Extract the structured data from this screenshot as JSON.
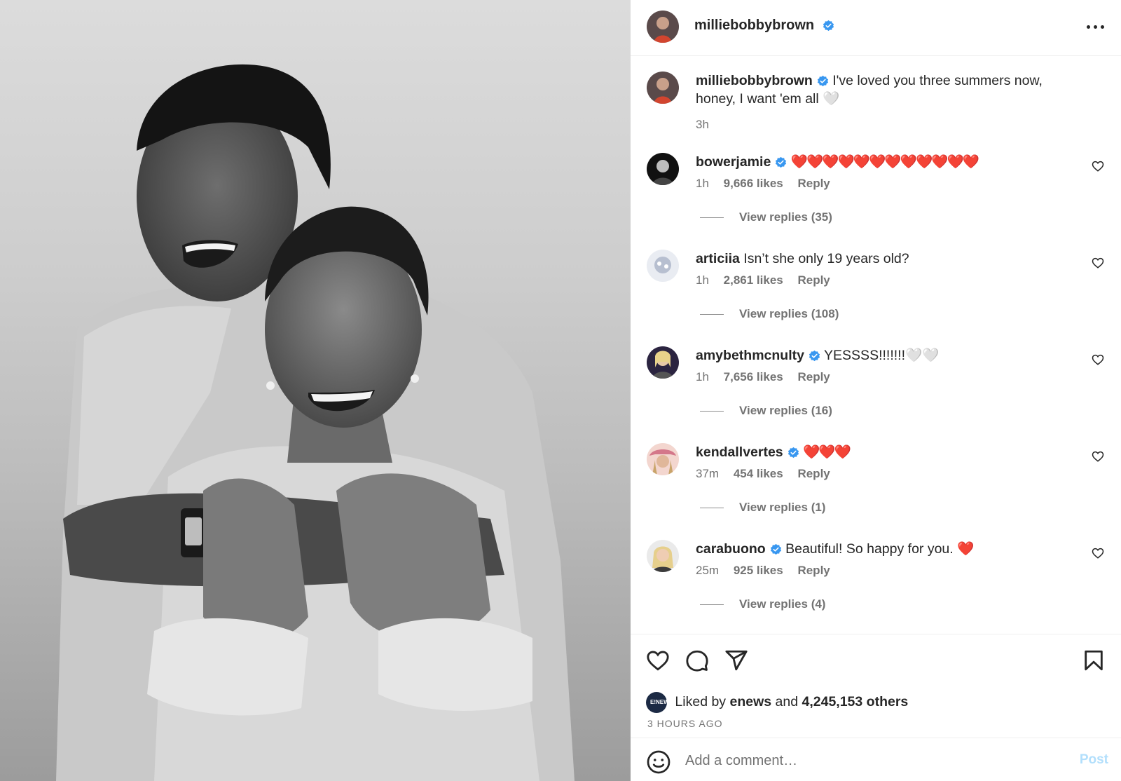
{
  "post": {
    "author": "milliebobbybrown",
    "more_label": "…",
    "caption": {
      "username": "milliebobbybrown",
      "text": "I've loved you three summers now, honey, I want 'em all 🤍",
      "time": "3h"
    }
  },
  "comments": [
    {
      "username": "bowerjamie",
      "verified": true,
      "text": "❤️❤️❤️❤️❤️❤️❤️❤️❤️❤️❤️❤️",
      "time": "1h",
      "likes": "9,666 likes",
      "reply": "Reply",
      "view_replies": "View replies (35)"
    },
    {
      "username": "articiia",
      "verified": false,
      "text": "Isn’t she only 19 years old?",
      "time": "1h",
      "likes": "2,861 likes",
      "reply": "Reply",
      "view_replies": "View replies (108)"
    },
    {
      "username": "amybethmcnulty",
      "verified": true,
      "text": "YESSSS!!!!!!!🤍🤍",
      "time": "1h",
      "likes": "7,656 likes",
      "reply": "Reply",
      "view_replies": "View replies (16)"
    },
    {
      "username": "kendallvertes",
      "verified": true,
      "text": "❤️❤️❤️",
      "time": "37m",
      "likes": "454 likes",
      "reply": "Reply",
      "view_replies": "View replies (1)"
    },
    {
      "username": "carabuono",
      "verified": true,
      "text": "Beautiful! So happy for you. ❤️",
      "time": "25m",
      "likes": "925 likes",
      "reply": "Reply",
      "view_replies": "View replies (4)"
    }
  ],
  "actions": {
    "liked_prefix": "Liked by",
    "liked_user": "enews",
    "liked_and": "and",
    "liked_others": "4,245,153 others",
    "enews_badge": "E!NEWS",
    "time_ago": "3 HOURS AGO"
  },
  "add_comment": {
    "placeholder": "Add a comment…",
    "post_label": "Post"
  },
  "colors": {
    "verified": "#3897f0",
    "text": "#262626",
    "secondary": "#737373",
    "post_disabled": "#b2dffc"
  }
}
